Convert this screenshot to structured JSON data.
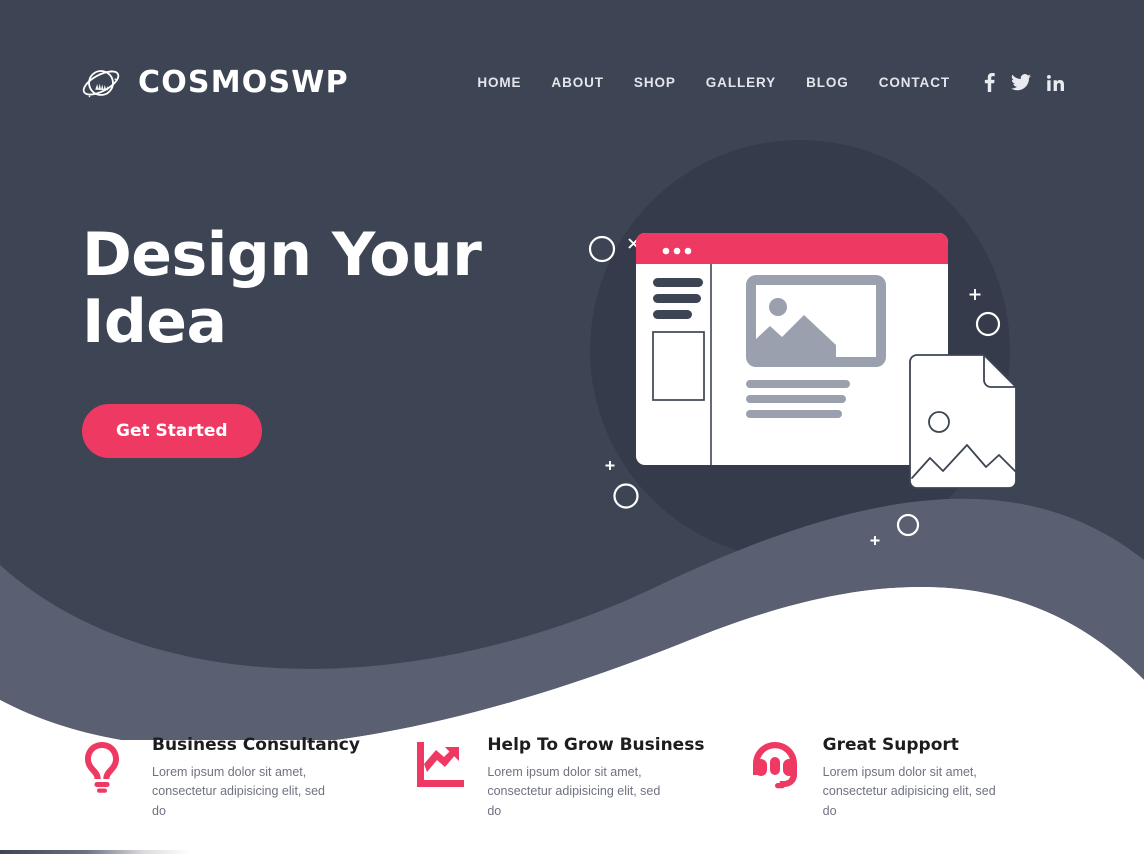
{
  "brand": {
    "name": "COSMOSWP",
    "logo_icon": "planet-ring-icon"
  },
  "nav": {
    "items": [
      {
        "label": "HOME"
      },
      {
        "label": "ABOUT"
      },
      {
        "label": "SHOP"
      },
      {
        "label": "GALLERY"
      },
      {
        "label": "BLOG"
      },
      {
        "label": "CONTACT"
      }
    ],
    "social": [
      {
        "name": "facebook-icon",
        "glyph": "f"
      },
      {
        "name": "twitter-icon",
        "glyph": "bird"
      },
      {
        "name": "linkedin-icon",
        "glyph": "in"
      }
    ]
  },
  "hero": {
    "title_line1": "Design Your",
    "title_line2": "Idea",
    "cta_label": "Get Started",
    "illustration": {
      "name": "website-builder-illustration",
      "browser_dots": 3,
      "card_icon": "image-document-icon"
    }
  },
  "features": [
    {
      "icon": "lightbulb-icon",
      "title": "Business Consultancy",
      "text": "Lorem ipsum dolor sit amet, consectetur adipisicing elit, sed do"
    },
    {
      "icon": "growth-chart-icon",
      "title": "Help To Grow Business",
      "text": "Lorem ipsum dolor sit amet, consectetur adipisicing elit, sed do"
    },
    {
      "icon": "headset-support-icon",
      "title": "Great Support",
      "text": "Lorem ipsum dolor sit amet, consectetur adipisicing elit, sed do"
    }
  ],
  "colors": {
    "dark": "#3d4454",
    "dark_circle": "#353b4b",
    "wave_light": "#5a6071",
    "accent": "#ee3a63",
    "white": "#ffffff",
    "muted": "#6f7380"
  }
}
